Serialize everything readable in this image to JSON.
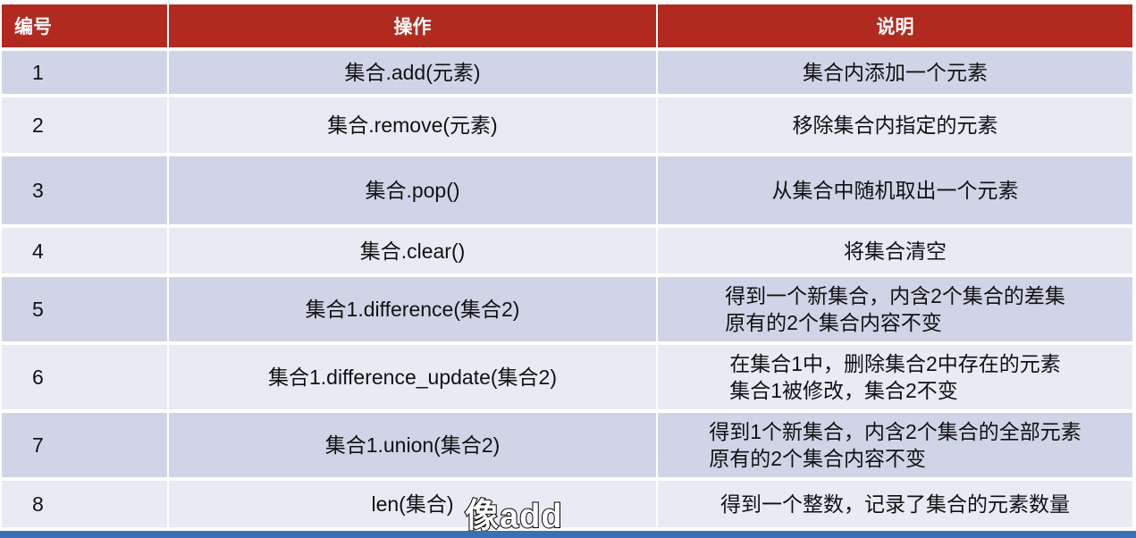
{
  "table": {
    "headers": [
      "编号",
      "操作",
      "说明"
    ],
    "rows": [
      {
        "num": "1",
        "op": "集合.add(元素)",
        "desc": [
          "集合内添加一个元素"
        ]
      },
      {
        "num": "2",
        "op": "集合.remove(元素)",
        "desc": [
          "移除集合内指定的元素"
        ]
      },
      {
        "num": "3",
        "op": "集合.pop()",
        "desc": [
          "从集合中随机取出一个元素"
        ]
      },
      {
        "num": "4",
        "op": "集合.clear()",
        "desc": [
          "将集合清空"
        ]
      },
      {
        "num": "5",
        "op": "集合1.difference(集合2)",
        "desc": [
          "得到一个新集合，内含2个集合的差集",
          "原有的2个集合内容不变"
        ]
      },
      {
        "num": "6",
        "op": "集合1.difference_update(集合2)",
        "desc": [
          "在集合1中，删除集合2中存在的元素",
          "集合1被修改，集合2不变"
        ]
      },
      {
        "num": "7",
        "op": "集合1.union(集合2)",
        "desc": [
          "得到1个新集合，内含2个集合的全部元素",
          "原有的2个集合内容不变"
        ]
      },
      {
        "num": "8",
        "op": "len(集合)",
        "desc": [
          "得到一个整数，记录了集合的元素数量"
        ]
      }
    ]
  },
  "subtitle": "像add",
  "colors": {
    "header_bg": "#b22a1f",
    "row_odd": "#cfd5e6",
    "row_even": "#e8ebf4",
    "bottom_bar": "#3b6fb5"
  }
}
